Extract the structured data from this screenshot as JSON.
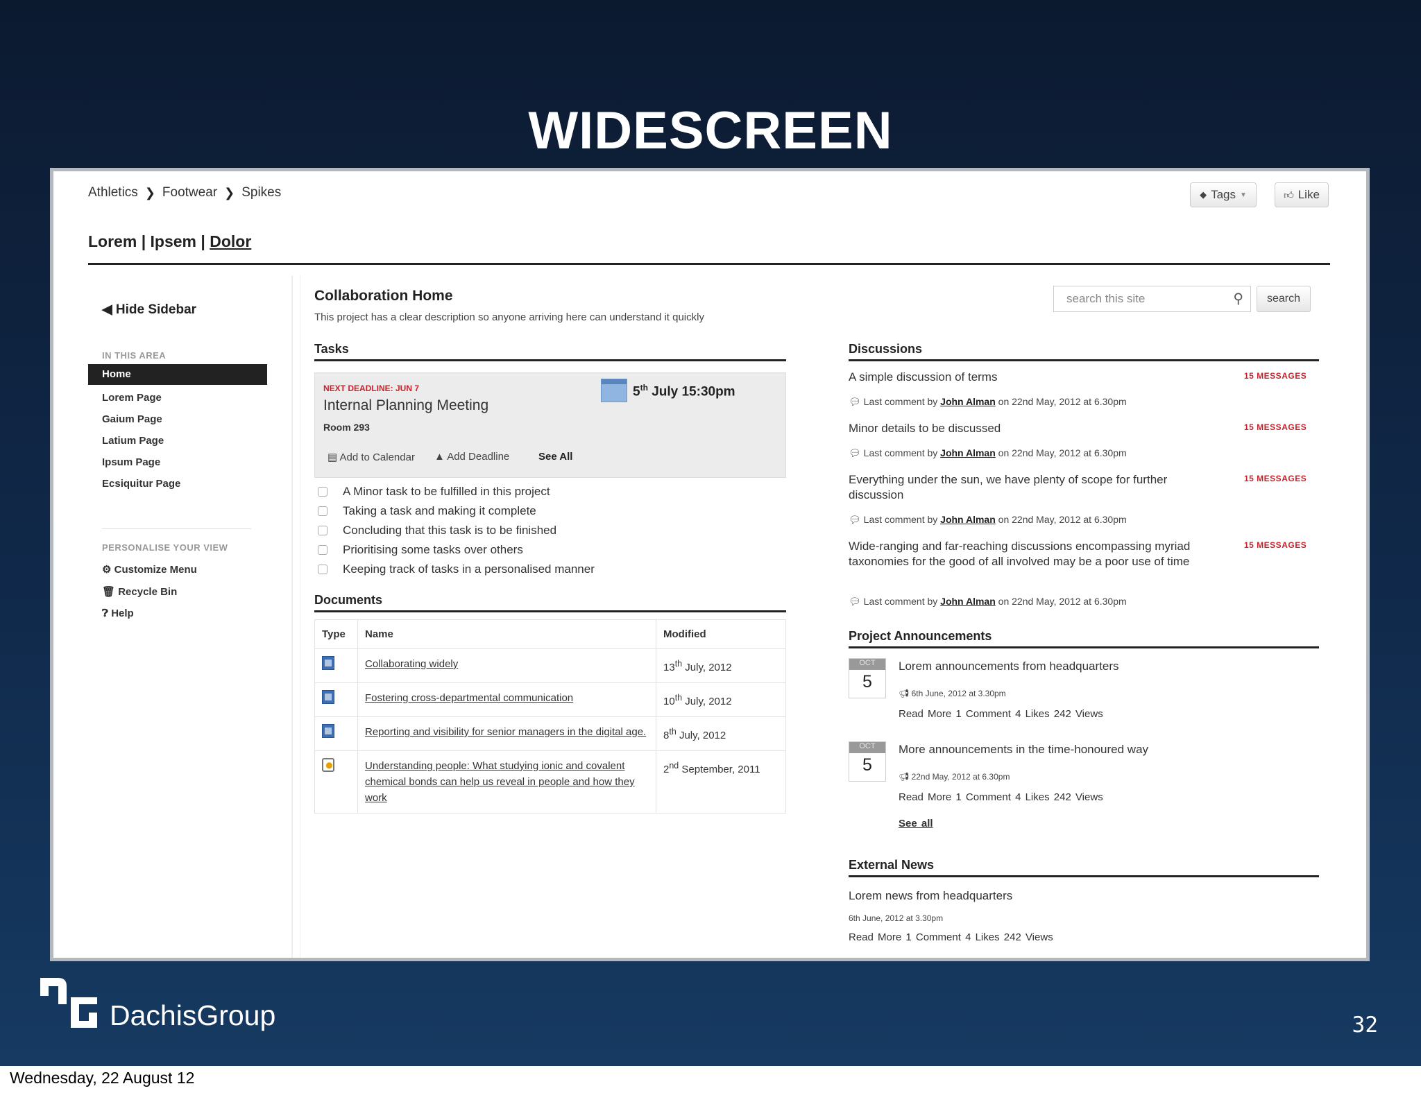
{
  "slide": {
    "title": "WIDESCREEN",
    "brand": "DachisGroup",
    "page_number": "32",
    "footer_date": "Wednesday, 22 August 12",
    "colors": {
      "background": "#10294a",
      "accent_red": "#c8232c"
    }
  },
  "app": {
    "breadcrumb": [
      "Athletics",
      "Footwear",
      "Spikes"
    ],
    "tags_label": "Tags",
    "like_label": "Like",
    "site_title": {
      "part1": "Lorem",
      "part2": "Ipsem",
      "part3": "Dolor",
      "separator": "|"
    },
    "sidebar": {
      "hide_label": "Hide Sidebar",
      "area_heading": "IN THIS AREA",
      "active_item": "Home",
      "items": [
        "Lorem Page",
        "Gaium Page",
        "Latium Page",
        "Ipsum Page",
        "Ecsiquitur Page"
      ],
      "personalise_heading": "PERSONALISE YOUR VIEW",
      "personal_items": [
        "Customize Menu",
        "Recycle Bin",
        "Help"
      ]
    },
    "main": {
      "title": "Collaboration Home",
      "description": "This project has a clear description so anyone arriving here can understand it quickly",
      "search_placeholder": "search this site",
      "search_button": "search"
    },
    "tasks": {
      "heading": "Tasks",
      "deadline": {
        "tag": "NEXT DEADLINE: JUN 7",
        "title": "Internal Planning Meeting",
        "room": "Room 293",
        "date_day": "5",
        "date_sup": "th",
        "date_rest": "July 15:30pm",
        "add_calendar": "Add to Calendar",
        "add_deadline": "Add Deadline",
        "see_all": "See All"
      },
      "items": [
        "A Minor task to be fulfilled in this project",
        "Taking a task and making it complete",
        "Concluding that this task is to be finished",
        "Prioritising some tasks over others",
        "Keeping track of tasks in a personalised manner"
      ]
    },
    "documents": {
      "heading": "Documents",
      "columns": [
        "Type",
        "Name",
        "Modified"
      ],
      "rows": [
        {
          "icon": "word-doc-icon",
          "name": "Collaborating widely",
          "day": "13",
          "sup": "th",
          "rest": "July, 2012"
        },
        {
          "icon": "word-doc-icon",
          "name": "Fostering cross-departmental communication",
          "day": "10",
          "sup": "th",
          "rest": "July, 2012"
        },
        {
          "icon": "word-doc-icon",
          "name": "Reporting and visibility for senior managers in the digital age.",
          "day": "8",
          "sup": "th",
          "rest": "July, 2012"
        },
        {
          "icon": "image-file-icon",
          "name": "Understanding people: What studying ionic and covalent chemical bonds can help us reveal in people and how they work",
          "day": "2",
          "sup": "nd",
          "rest": "September, 2011"
        }
      ]
    },
    "discussions": {
      "heading": "Discussions",
      "items": [
        {
          "title": "A simple discussion of terms",
          "messages": "15 MESSAGES",
          "meta_prefix": "Last comment by",
          "author": "John Alman",
          "meta_suffix": "on 22nd May, 2012 at 6.30pm"
        },
        {
          "title": "Minor details to be discussed",
          "messages": "15 MESSAGES",
          "meta_prefix": "Last comment by",
          "author": "John Alman",
          "meta_suffix": "on 22nd May, 2012 at 6.30pm"
        },
        {
          "title": "Everything under the sun, we have plenty of scope for further discussion",
          "messages": "15 MESSAGES",
          "meta_prefix": "Last comment by",
          "author": "John Alman",
          "meta_suffix": "on 22nd May, 2012 at 6.30pm"
        },
        {
          "title": "Wide-ranging and far-reaching discussions encompassing myriad taxonomies for the good of all involved may be a poor use of time",
          "messages": "15 MESSAGES",
          "meta_prefix": "Last comment by",
          "author": "John Alman",
          "meta_suffix": "on 22nd May, 2012 at 6.30pm"
        }
      ]
    },
    "announcements": {
      "heading": "Project Announcements",
      "items": [
        {
          "month": "OCT",
          "day": "5",
          "title": "Lorem announcements from headquarters",
          "stamp": "6th June, 2012 at 3.30pm",
          "footer": "Read More   1 Comment   4 Likes   242 Views"
        },
        {
          "month": "OCT",
          "day": "5",
          "title": "More announcements in the time-honoured way",
          "stamp": "22nd May, 2012 at 6.30pm",
          "footer": "Read More   1 Comment   4 Likes   242 Views"
        }
      ],
      "see_all": "See all"
    },
    "external_news": {
      "heading": "External News",
      "title": "Lorem news from headquarters",
      "stamp": "6th June, 2012 at 3.30pm",
      "footer": "Read More   1 Comment   4 Likes   242 Views"
    }
  }
}
